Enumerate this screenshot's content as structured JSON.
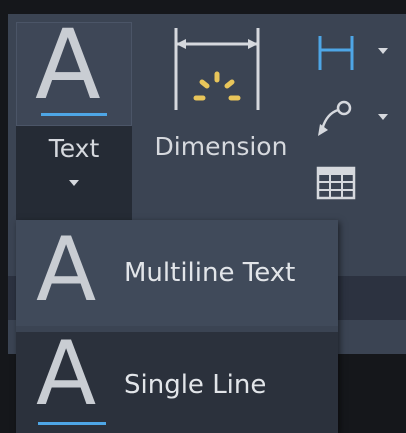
{
  "ribbon": {
    "text_button": {
      "label": "Text",
      "icon": "text-A-icon"
    },
    "dimension_button": {
      "label": "Dimension",
      "icon": "dimension-icon"
    },
    "small_tools": [
      {
        "icon": "linear-dimension-icon",
        "has_dropdown": true
      },
      {
        "icon": "leader-icon",
        "has_dropdown": true
      },
      {
        "icon": "table-icon",
        "has_dropdown": false
      }
    ]
  },
  "menu": {
    "items": [
      {
        "label": "Multiline Text",
        "icon": "multiline-text-icon"
      },
      {
        "label": "Single Line",
        "icon": "single-line-text-icon"
      }
    ]
  },
  "colors": {
    "ribbon_bg": "#3b4453",
    "accent_underline": "#4ea6e6",
    "dimension_star": "#e8c55a",
    "text": "#d6d9de"
  }
}
